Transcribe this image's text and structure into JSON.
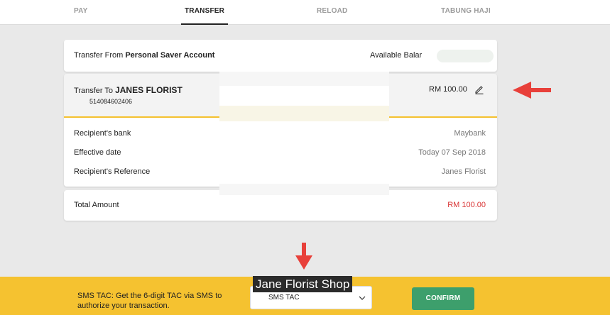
{
  "tabs": [
    {
      "label": "PAY",
      "active": false
    },
    {
      "label": "TRANSFER",
      "active": true
    },
    {
      "label": "RELOAD",
      "active": false
    },
    {
      "label": "TABUNG HAJI",
      "active": false
    }
  ],
  "transfer_from": {
    "prefix": "Transfer From",
    "account": "Personal Saver Account",
    "balance_label": "Available Balar"
  },
  "transfer_to": {
    "prefix": "Transfer To",
    "name": "JANES FLORIST",
    "account_number": "514084602406",
    "amount": "RM 100.00",
    "edit_icon": "pencil-icon"
  },
  "details": [
    {
      "label": "Recipient's bank",
      "value": "Maybank"
    },
    {
      "label": "Effective date",
      "value": "Today 07 Sep 2018"
    },
    {
      "label": "Recipient's Reference",
      "value": "Janes Florist"
    }
  ],
  "total": {
    "label": "Total Amount",
    "value": "RM 100.00"
  },
  "bottom_bar": {
    "tac_text": "SMS TAC: Get the 6-digit TAC via SMS to authorize your transaction.",
    "tac_method": "SMS TAC",
    "confirm_label": "CONFIRM"
  },
  "annotation": {
    "label": "Jane Florist Shop"
  },
  "colors": {
    "accent_yellow": "#f5c230",
    "confirm_green": "#3d9f6c",
    "amount_red": "#d93434",
    "arrow_red": "#e8403a"
  }
}
